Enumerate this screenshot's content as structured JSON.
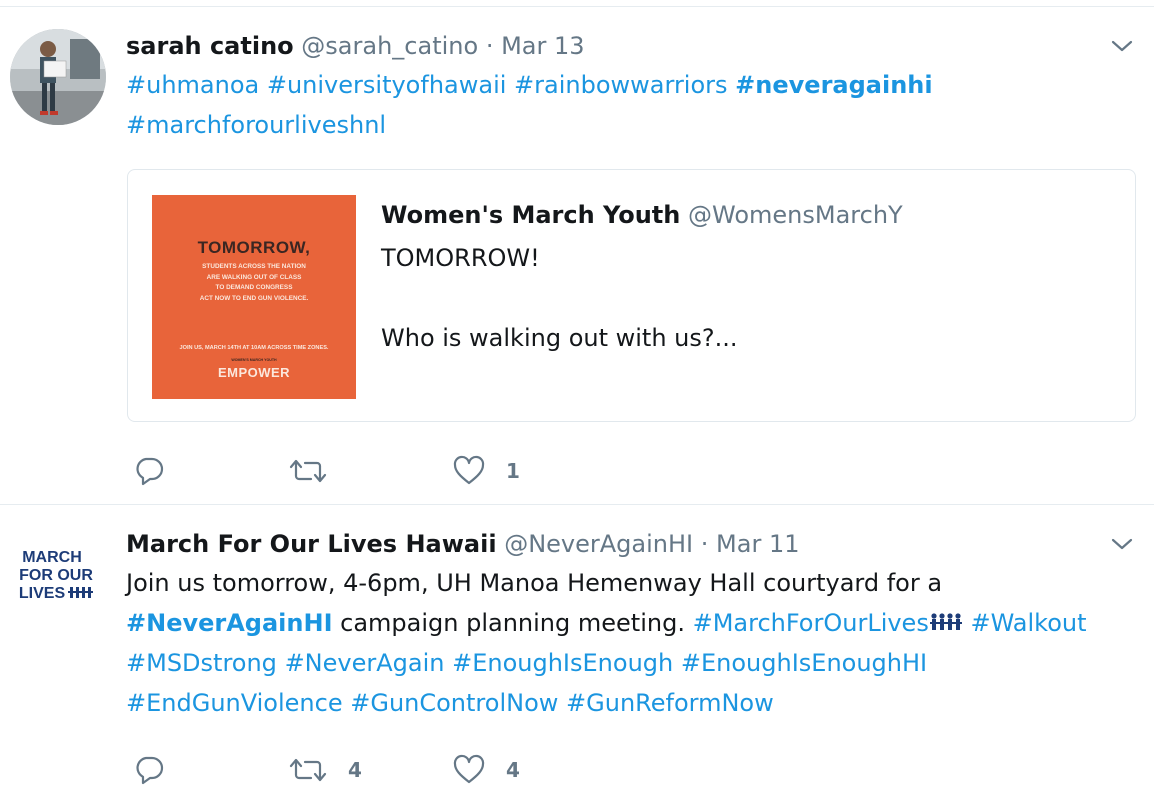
{
  "colors": {
    "link": "#1b95e0",
    "muted": "#657786",
    "text": "#14171a",
    "border": "#e1e8ed",
    "card_image_bg": "#e8643a"
  },
  "tweets": [
    {
      "name": "sarah catino",
      "handle": "@sarah_catino",
      "separator": "·",
      "date": "Mar 13",
      "hashtags_line1": [
        "#uhmanoa",
        "#universityofhawaii",
        "#rainbowwarriors"
      ],
      "hashtag_bold": "#neveragainhi",
      "hashtag_line2": "#marchforourliveshnl",
      "quote": {
        "name": "Women's March Youth",
        "handle": "@WomensMarchY",
        "text": "TOMORROW!\n\nWho is walking out with us?...",
        "image": {
          "title": "TOMORROW,",
          "lines": [
            "STUDENTS ACROSS THE NATION",
            "ARE WALKING OUT OF CLASS",
            "TO DEMAND CONGRESS",
            "ACT NOW TO END GUN VIOLENCE."
          ],
          "join": "JOIN US, MARCH 14TH AT 10AM ACROSS TIME ZONES.",
          "sub": "WOMEN'S MARCH YOUTH",
          "brand": "EMPOWER"
        }
      },
      "actions": {
        "reply_icon": "reply-icon",
        "retweet_icon": "retweet-icon",
        "like_icon": "heart-icon",
        "retweets": "",
        "likes": "1"
      }
    },
    {
      "name": "March For Our Lives Hawaii",
      "handle": "@NeverAgainHI",
      "separator": "·",
      "date": "Mar 11",
      "line1": "Join us tomorrow, 4-6pm, UH Manoa Hemenway Hall courtyard for a",
      "tag_bold": "#NeverAgainHI",
      "line2_text": " campaign planning meeting. ",
      "tag_mfol": "#MarchForOurLives",
      "tag_walkout": "#Walkout",
      "line3": [
        "#MSDstrong",
        "#NeverAgain",
        "#EnoughIsEnough",
        "#EnoughIsEnoughHI"
      ],
      "line4": [
        "#EndGunViolence",
        "#GunControlNow",
        "#GunReformNow"
      ],
      "avatar": {
        "line1": "MARCH",
        "line2": "FOR OUR",
        "line3": "LIVES"
      },
      "actions": {
        "reply_icon": "reply-icon",
        "retweet_icon": "retweet-icon",
        "like_icon": "heart-icon",
        "retweets": "4",
        "likes": "4"
      }
    }
  ]
}
